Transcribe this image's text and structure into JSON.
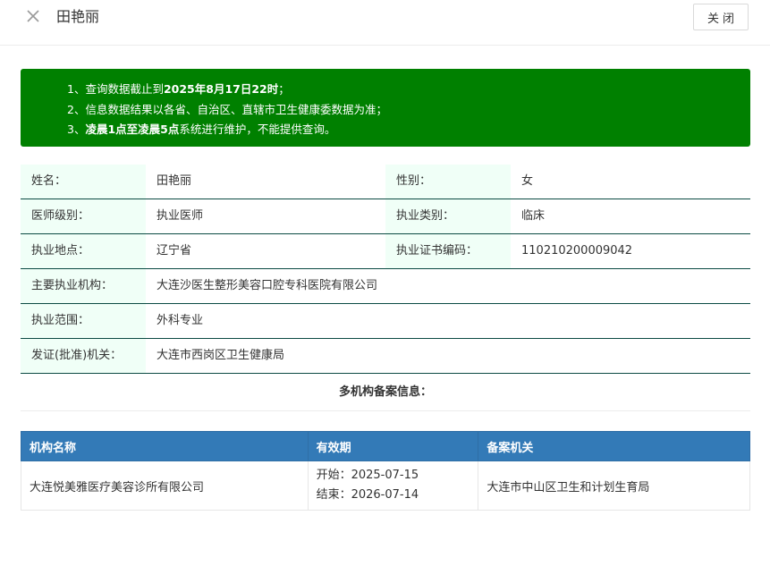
{
  "header": {
    "title": "田艳丽",
    "close_label": "关闭"
  },
  "notice": {
    "line1_prefix": "1、查询数据截止到",
    "line1_bold": "2025年8月17日22时",
    "line1_suffix": "；",
    "line2": "2、信息数据结果以各省、自治区、直辖市卫生健康委数据为准；",
    "line3_prefix": "3、",
    "line3_bold": "凌晨1点至凌晨5点",
    "line3_suffix": "系统进行维护，不能提供查询。",
    "bg_color": "#008000"
  },
  "info": {
    "name_label": "姓名：",
    "name_value": "田艳丽",
    "gender_label": "性别：",
    "gender_value": "女",
    "level_label": "医师级别：",
    "level_value": "执业医师",
    "category_label": "执业类别：",
    "category_value": "临床",
    "location_label": "执业地点：",
    "location_value": "辽宁省",
    "cert_label": "执业证书编码：",
    "cert_value": "110210200009042",
    "org_label": "主要执业机构：",
    "org_value": "大连沙医生整形美容口腔专科医院有限公司",
    "scope_label": "执业范围：",
    "scope_value": "外科专业",
    "issuer_label": "发证(批准)机关：",
    "issuer_value": "大连市西岗区卫生健康局"
  },
  "multi": {
    "title": "多机构备案信息：",
    "columns": [
      "机构名称",
      "有效期",
      "备案机关"
    ],
    "rows": [
      {
        "org": "大连悦美雅医疗美容诊所有限公司",
        "start": "开始：2025-07-15",
        "end": "结束：2026-07-14",
        "authority": "大连市中山区卫生和计划生育局"
      }
    ],
    "header_color": "#337ab7"
  }
}
